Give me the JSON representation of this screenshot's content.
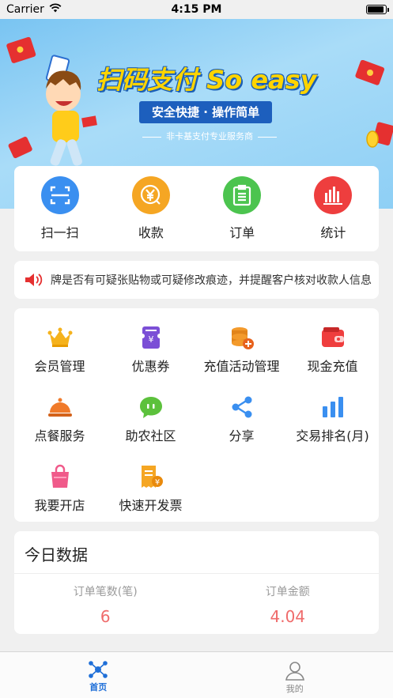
{
  "status_bar": {
    "carrier": "Carrier",
    "time": "4:15 PM"
  },
  "banner": {
    "title": "扫码支付 So easy",
    "subtitle": "安全快捷 · 操作简单",
    "caption": "非卡基支付专业服务商"
  },
  "quick_actions": [
    {
      "label": "扫一扫",
      "icon": "scan-icon",
      "color": "#3a8ff0"
    },
    {
      "label": "收款",
      "icon": "yuan-icon",
      "color": "#f5a623"
    },
    {
      "label": "订单",
      "icon": "clipboard-icon",
      "color": "#4cc44f"
    },
    {
      "label": "统计",
      "icon": "bar-chart-icon",
      "color": "#ee3e3e"
    }
  ],
  "notice": {
    "text": "牌是否有可疑张贴物或可疑修改痕迹，并提醒客户核对收款人信息"
  },
  "services": [
    {
      "label": "会员管理",
      "icon": "crown-icon"
    },
    {
      "label": "优惠券",
      "icon": "coupon-icon"
    },
    {
      "label": "充值活动管理",
      "icon": "coin-stack-icon"
    },
    {
      "label": "现金充值",
      "icon": "wallet-icon"
    },
    {
      "label": "点餐服务",
      "icon": "food-cloche-icon"
    },
    {
      "label": "助农社区",
      "icon": "chat-bubble-icon"
    },
    {
      "label": "分享",
      "icon": "share-icon"
    },
    {
      "label": "交易排名(月)",
      "icon": "ranking-bars-icon"
    },
    {
      "label": "我要开店",
      "icon": "shopping-bag-icon"
    },
    {
      "label": "快速开发票",
      "icon": "invoice-icon"
    }
  ],
  "today": {
    "title": "今日数据",
    "orders_label": "订单笔数(笔)",
    "orders_value": "6",
    "amount_label": "订单金额",
    "amount_value": "4.04"
  },
  "tabs": [
    {
      "label": "首页",
      "icon": "home-network-icon",
      "active": true
    },
    {
      "label": "我的",
      "icon": "person-icon",
      "active": false
    }
  ],
  "colors": {
    "accent": "#1f6fd8",
    "value_red": "#ef6b6b",
    "banner_blue": "#79c4f2"
  },
  "battery_level": 0.9
}
